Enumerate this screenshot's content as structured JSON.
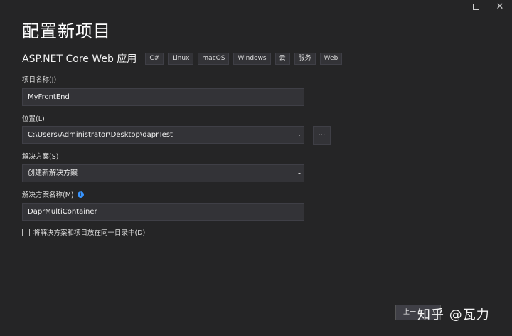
{
  "window": {
    "maximize_icon": "maximize-icon",
    "close_icon": "close-icon",
    "close_glyph": "✕"
  },
  "page": {
    "title": "配置新项目",
    "template_name": "ASP.NET Core Web 应用",
    "tags": [
      "C#",
      "Linux",
      "macOS",
      "Windows",
      "云",
      "服务",
      "Web"
    ]
  },
  "form": {
    "project_name": {
      "label": "项目名称(J)",
      "value": "MyFrontEnd"
    },
    "location": {
      "label": "位置(L)",
      "value": "C:\\Users\\Administrator\\Desktop\\daprTest",
      "browse_label": "..."
    },
    "solution": {
      "label": "解决方案(S)",
      "value": "创建新解决方案"
    },
    "solution_name": {
      "label": "解决方案名称(M)",
      "value": "DaprMultiContainer",
      "info_glyph": "i"
    },
    "same_dir": {
      "label": "将解决方案和项目放在同一目录中(D)",
      "checked": false
    }
  },
  "footer": {
    "prev_button_label": "上一",
    "watermark": "知乎 @瓦力"
  },
  "colors": {
    "background": "#252526",
    "field_bg": "#333337",
    "border": "#3f3f46",
    "accent": "#3794ff"
  }
}
